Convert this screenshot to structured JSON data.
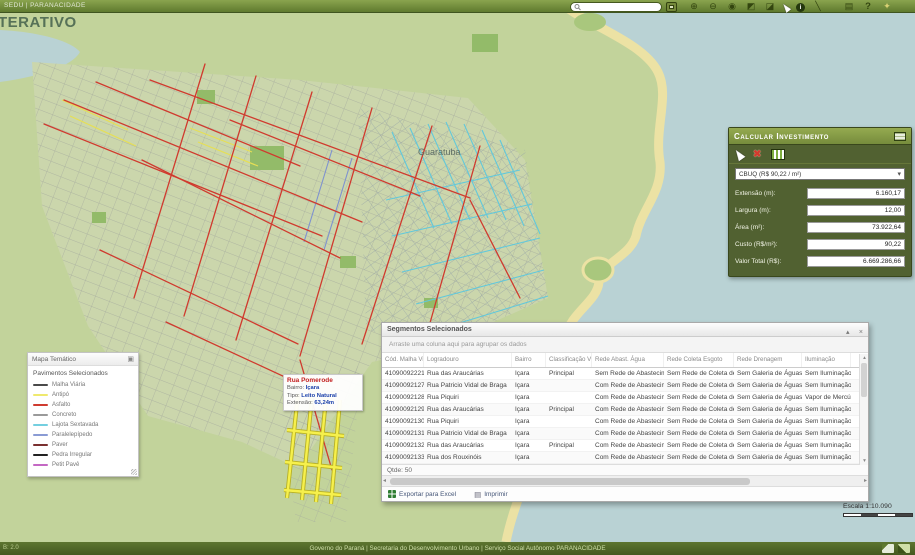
{
  "app": {
    "logo_text": "SEDU | PARANACIDADE",
    "map_title_fragment": "TERATIVO",
    "footer": {
      "left_text": "B: 2.0",
      "credit": "Governo do Paraná | Secretaria do Desenvolvimento Urbano | Serviço Social Autônomo PARANACIDADE"
    }
  },
  "toolbar": {
    "search": {
      "value": "",
      "placeholder": ""
    },
    "icons": [
      {
        "name": "zoom-in-icon",
        "glyph": "⊕"
      },
      {
        "name": "zoom-out-icon",
        "glyph": "⊖"
      },
      {
        "name": "globe-icon",
        "glyph": "◉"
      },
      {
        "name": "zoom-previous-icon",
        "glyph": "◩"
      },
      {
        "name": "zoom-next-icon",
        "glyph": "◪"
      },
      {
        "name": "pointer-icon",
        "glyph": ""
      },
      {
        "name": "info-icon",
        "glyph": "i"
      },
      {
        "name": "measure-icon",
        "glyph": "╲"
      },
      {
        "name": "print-icon",
        "glyph": "▤"
      },
      {
        "name": "help-icon",
        "glyph": "?"
      },
      {
        "name": "key-icon",
        "glyph": "✦"
      }
    ]
  },
  "map": {
    "city_label": "Guaratuba",
    "selection_color": "#f6f04c",
    "scale": {
      "label": "Escala 1:10.090"
    },
    "tooltip": {
      "title": "Rua Pomerode",
      "rows": [
        {
          "label": "Bairro:",
          "value": "Içara"
        },
        {
          "label": "Tipo:",
          "value": "Leito Natural"
        },
        {
          "label": "Extensão:",
          "value": "63,24m"
        }
      ]
    },
    "legend": {
      "title": "Mapa Temático",
      "heading": "Pavimentos Selecionados",
      "items": [
        {
          "label": "Malha Viária",
          "color": "#4a4a4a"
        },
        {
          "label": "Antipó",
          "color": "#efe96e"
        },
        {
          "label": "Asfalto",
          "color": "#cf3b30"
        },
        {
          "label": "Concreto",
          "color": "#9a9a9a"
        },
        {
          "label": "Lajota Sextavada",
          "color": "#74cfe0"
        },
        {
          "label": "Paralelepípedo",
          "color": "#8a9bd4"
        },
        {
          "label": "Paver",
          "color": "#7a3030"
        },
        {
          "label": "Pedra Irregular",
          "color": "#222222"
        },
        {
          "label": "Petit Pavê",
          "color": "#c468c4"
        }
      ]
    }
  },
  "invest_panel": {
    "title": "Calcular Investimento",
    "pavement_select": "CBUQ (R$ 90,22 / m²)",
    "fields": [
      {
        "label": "Extensão (m):",
        "value": "6.160,17"
      },
      {
        "label": "Largura (m):",
        "value": "12,00"
      },
      {
        "label": "Área (m²):",
        "value": "73.922,64"
      },
      {
        "label": "Custo (R$/m²):",
        "value": "90,22"
      },
      {
        "label": "Valor Total (R$):",
        "value": "6.669.286,66"
      }
    ]
  },
  "segments_window": {
    "title": "Segmentos Selecionados",
    "group_hint": "Arraste uma coluna aqui para agrupar os dados",
    "columns": [
      "Cód. Malha Viária",
      "Logradouro",
      "Bairro",
      "Classificação Via",
      "Rede Abast. Água",
      "Rede Coleta Esgoto",
      "Rede Drenagem",
      "Iluminação"
    ],
    "rows": [
      [
        "41090092221",
        "Rua das Araucárias",
        "Içara",
        "Principal",
        "Sem Rede de Abastecime...",
        "Sem Rede de Coleta de E...",
        "Sem Galeria de Águas Pl...",
        "Sem Iluminação"
      ],
      [
        "41090092127",
        "Rua Patricio Vidal de Braga",
        "Içara",
        "",
        "Com Rede de Abastecim...",
        "Sem Rede de Coleta de E...",
        "Sem Galeria de Águas Pl...",
        "Sem Iluminação"
      ],
      [
        "41090092128",
        "Rua Piquiri",
        "Içara",
        "",
        "Com Rede de Abastecim...",
        "Sem Rede de Coleta de E...",
        "Sem Galeria de Águas Pl...",
        "Vapor de Mercúrio"
      ],
      [
        "41090092129",
        "Rua das Araucárias",
        "Içara",
        "Principal",
        "Com Rede de Abastecim...",
        "Sem Rede de Coleta de E...",
        "Sem Galeria de Águas Pl...",
        "Sem Iluminação"
      ],
      [
        "41090092130",
        "Rua Piquiri",
        "Içara",
        "",
        "Com Rede de Abastecim...",
        "Sem Rede de Coleta de E...",
        "Sem Galeria de Águas Pl...",
        "Sem Iluminação"
      ],
      [
        "41090092131",
        "Rua Patricio Vidal de Braga",
        "Içara",
        "",
        "Com Rede de Abastecim...",
        "Sem Rede de Coleta de E...",
        "Sem Galeria de Águas Pl...",
        "Sem Iluminação"
      ],
      [
        "41090092132",
        "Rua das Araucárias",
        "Içara",
        "Principal",
        "Com Rede de Abastecim...",
        "Sem Rede de Coleta de E...",
        "Sem Galeria de Águas Pl...",
        "Sem Iluminação"
      ],
      [
        "41090092133",
        "Rua dos Rouxinóis",
        "Içara",
        "",
        "Com Rede de Abastecim...",
        "Sem Rede de Coleta de E...",
        "Sem Galeria de Águas Pl...",
        "Sem Iluminação"
      ]
    ],
    "count_label": "Qtde: 50",
    "buttons": {
      "export": "Exportar para Excel",
      "print": "Imprimir"
    }
  }
}
